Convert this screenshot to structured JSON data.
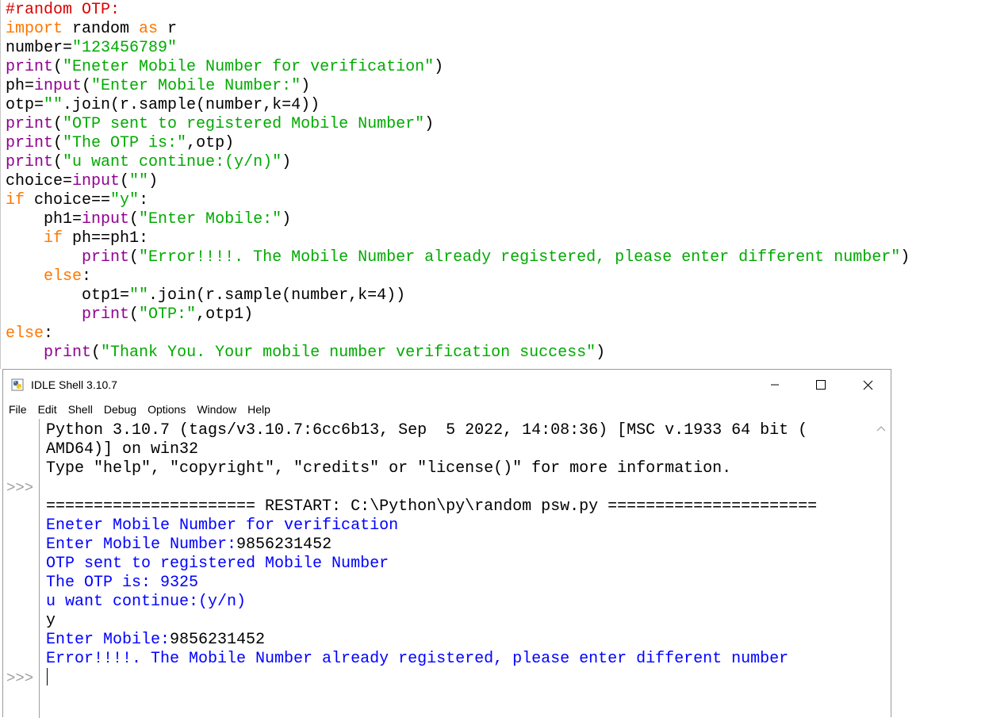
{
  "editor": {
    "lines": [
      [
        {
          "t": "#random OTP:",
          "c": "cm"
        }
      ],
      [
        {
          "t": "import",
          "c": "kw"
        },
        {
          "t": " random "
        },
        {
          "t": "as",
          "c": "kw"
        },
        {
          "t": " r"
        }
      ],
      [
        {
          "t": "number="
        },
        {
          "t": "\"123456789\"",
          "c": "str"
        }
      ],
      [
        {
          "t": "print",
          "c": "bi"
        },
        {
          "t": "("
        },
        {
          "t": "\"Eneter Mobile Number for verification\"",
          "c": "str"
        },
        {
          "t": ")"
        }
      ],
      [
        {
          "t": "ph="
        },
        {
          "t": "input",
          "c": "bi"
        },
        {
          "t": "("
        },
        {
          "t": "\"Enter Mobile Number:\"",
          "c": "str"
        },
        {
          "t": ")"
        }
      ],
      [
        {
          "t": "otp="
        },
        {
          "t": "\"\"",
          "c": "str"
        },
        {
          "t": ".join(r.sample(number,k=4))"
        }
      ],
      [
        {
          "t": "print",
          "c": "bi"
        },
        {
          "t": "("
        },
        {
          "t": "\"OTP sent to registered Mobile Number\"",
          "c": "str"
        },
        {
          "t": ")"
        }
      ],
      [
        {
          "t": "print",
          "c": "bi"
        },
        {
          "t": "("
        },
        {
          "t": "\"The OTP is:\"",
          "c": "str"
        },
        {
          "t": ",otp)"
        }
      ],
      [
        {
          "t": "print",
          "c": "bi"
        },
        {
          "t": "("
        },
        {
          "t": "\"u want continue:(y/n)\"",
          "c": "str"
        },
        {
          "t": ")"
        }
      ],
      [
        {
          "t": "choice="
        },
        {
          "t": "input",
          "c": "bi"
        },
        {
          "t": "("
        },
        {
          "t": "\"\"",
          "c": "str"
        },
        {
          "t": ")"
        }
      ],
      [
        {
          "t": "if",
          "c": "kw"
        },
        {
          "t": " choice=="
        },
        {
          "t": "\"y\"",
          "c": "str"
        },
        {
          "t": ":"
        }
      ],
      [
        {
          "t": "    ph1="
        },
        {
          "t": "input",
          "c": "bi"
        },
        {
          "t": "("
        },
        {
          "t": "\"Enter Mobile:\"",
          "c": "str"
        },
        {
          "t": ")"
        }
      ],
      [
        {
          "t": "    "
        },
        {
          "t": "if",
          "c": "kw"
        },
        {
          "t": " ph==ph1:"
        }
      ],
      [
        {
          "t": "        "
        },
        {
          "t": "print",
          "c": "bi"
        },
        {
          "t": "("
        },
        {
          "t": "\"Error!!!!. The Mobile Number already registered, please enter different number\"",
          "c": "str"
        },
        {
          "t": ")"
        }
      ],
      [
        {
          "t": "    "
        },
        {
          "t": "else",
          "c": "kw"
        },
        {
          "t": ":"
        }
      ],
      [
        {
          "t": "        otp1="
        },
        {
          "t": "\"\"",
          "c": "str"
        },
        {
          "t": ".join(r.sample(number,k=4))"
        }
      ],
      [
        {
          "t": "        "
        },
        {
          "t": "print",
          "c": "bi"
        },
        {
          "t": "("
        },
        {
          "t": "\"OTP:\"",
          "c": "str"
        },
        {
          "t": ",otp1)"
        }
      ],
      [
        {
          "t": "else",
          "c": "kw"
        },
        {
          "t": ":"
        }
      ],
      [
        {
          "t": "    "
        },
        {
          "t": "print",
          "c": "bi"
        },
        {
          "t": "("
        },
        {
          "t": "\"Thank You. Your mobile number verification success\"",
          "c": "str"
        },
        {
          "t": ")"
        }
      ]
    ]
  },
  "shell": {
    "title": "IDLE Shell 3.10.7",
    "menu": [
      "File",
      "Edit",
      "Shell",
      "Debug",
      "Options",
      "Window",
      "Help"
    ],
    "prompt": ">>>",
    "lines": [
      {
        "text": "Python 3.10.7 (tags/v3.10.7:6cc6b13, Sep  5 2022, 14:08:36) [MSC v.1933 64 bit (",
        "cls": ""
      },
      {
        "text": "AMD64)] on win32",
        "cls": ""
      },
      {
        "text": "Type \"help\", \"copyright\", \"credits\" or \"license()\" for more information.",
        "cls": ""
      },
      {
        "text": "",
        "cls": ""
      },
      {
        "text": "====================== RESTART: C:\\Python\\py\\random psw.py ======================",
        "cls": ""
      },
      {
        "text": "Eneter Mobile Number for verification",
        "cls": "out"
      },
      {
        "text": "Enter Mobile Number:",
        "cls": "out",
        "input": "9856231452"
      },
      {
        "text": "OTP sent to registered Mobile Number",
        "cls": "out"
      },
      {
        "text": "The OTP is: 9325",
        "cls": "out"
      },
      {
        "text": "u want continue:(y/n)",
        "cls": "out"
      },
      {
        "text": "y",
        "cls": ""
      },
      {
        "text": "Enter Mobile:",
        "cls": "out",
        "input": "9856231452"
      },
      {
        "text": "Error!!!!. The Mobile Number already registered, please enter different number",
        "cls": "out"
      }
    ],
    "prompt_rows": [
      3,
      13
    ]
  },
  "icons": {
    "app": "python-idle-icon",
    "minimize": "minimize-icon",
    "maximize": "maximize-icon",
    "close": "close-icon",
    "scroll_up": "chevron-up-icon"
  }
}
